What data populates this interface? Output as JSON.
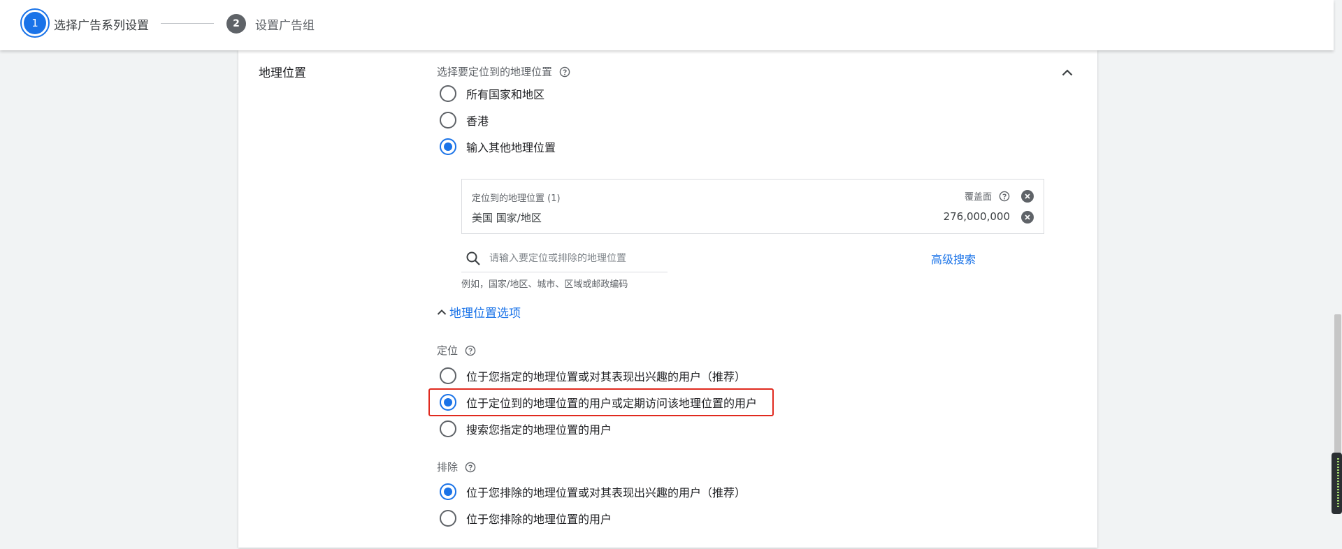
{
  "stepper": {
    "step1": {
      "number": "1",
      "label": "选择广告系列设置"
    },
    "step2": {
      "number": "2",
      "label": "设置广告组"
    }
  },
  "section": {
    "title": "地理位置"
  },
  "location": {
    "prompt": "选择要定位到的地理位置",
    "options": [
      {
        "label": "所有国家和地区",
        "selected": false
      },
      {
        "label": "香港",
        "selected": false
      },
      {
        "label": "输入其他地理位置",
        "selected": true
      }
    ]
  },
  "targets": {
    "header": "定位到的地理位置 (1)",
    "coverage_label": "覆盖面",
    "items": [
      {
        "name": "美国 国家/地区",
        "reach": "276,000,000"
      }
    ]
  },
  "search": {
    "placeholder": "请输入要定位或排除的地理位置",
    "advanced_label": "高级搜索",
    "hint": "例如，国家/地区、城市、区域或邮政编码"
  },
  "location_options": {
    "toggle_label": "地理位置选项"
  },
  "targeting": {
    "label": "定位",
    "options": [
      {
        "label": "位于您指定的地理位置或对其表现出兴趣的用户（推荐）",
        "selected": false
      },
      {
        "label": "位于定位到的地理位置的用户或定期访问该地理位置的用户",
        "selected": true
      },
      {
        "label": "搜索您指定的地理位置的用户",
        "selected": false
      }
    ]
  },
  "exclusion": {
    "label": "排除",
    "options": [
      {
        "label": "位于您排除的地理位置或对其表现出兴趣的用户（推荐）",
        "selected": true
      },
      {
        "label": "位于您排除的地理位置的用户",
        "selected": false
      }
    ]
  },
  "colors": {
    "accent": "#1a73e8",
    "highlight": "#e02a1f",
    "icon": "#5f6368"
  }
}
